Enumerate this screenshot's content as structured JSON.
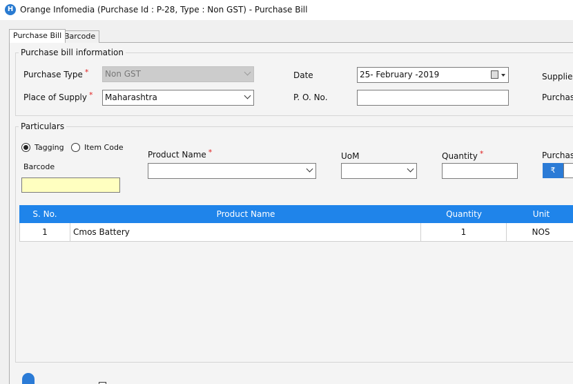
{
  "window": {
    "title": "Orange Infomedia (Purchase Id : P-28, Type : Non GST) - Purchase Bill",
    "icon_text": "H"
  },
  "tabs": [
    {
      "label": "Purchase Bill",
      "active": true
    },
    {
      "label": "Barcode",
      "active": false
    }
  ],
  "purchase_info": {
    "group_title": "Purchase bill information",
    "purchase_type_label": "Purchase Type",
    "purchase_type_value": "Non GST",
    "place_of_supply_label": "Place of Supply",
    "place_of_supply_value": "Maharashtra",
    "date_label": "Date",
    "date_value": "25-  February  -2019",
    "po_no_label": "P. O. No.",
    "po_no_value": "",
    "supplier_label": "Supplier",
    "purchase_label": "Purchase",
    "required_mark": "*"
  },
  "particulars": {
    "group_title": "Particulars",
    "radio_tagging": "Tagging",
    "radio_item_code": "Item Code",
    "barcode_label": "Barcode",
    "barcode_value": "",
    "product_name_label": "Product Name",
    "product_name_value": "",
    "uom_label": "UoM",
    "uom_value": "",
    "quantity_label": "Quantity",
    "quantity_value": "",
    "purchase_label": "Purchase",
    "currency_symbol": "₹"
  },
  "grid": {
    "columns": [
      "S. No.",
      "Product Name",
      "Quantity",
      "Unit"
    ],
    "rows": [
      {
        "sno": "1",
        "product_name": "Cmos Battery",
        "quantity": "1",
        "unit": "NOS"
      }
    ]
  },
  "colors": {
    "accent": "#1f84ea",
    "required": "#e02020",
    "barcode_bg": "#ffffc0"
  }
}
